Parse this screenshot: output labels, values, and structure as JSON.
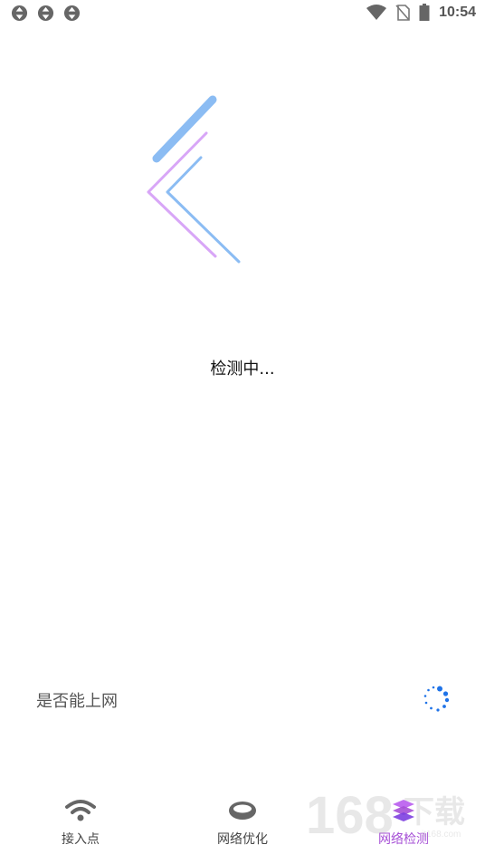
{
  "status_bar": {
    "time": "10:54",
    "left_icons": [
      "sync-icon",
      "sync-icon",
      "sync-icon"
    ],
    "right_icons": [
      "wifi-icon",
      "no-sim-icon",
      "battery-icon"
    ]
  },
  "main": {
    "status_text": "检测中...",
    "check_label": "是否能上网",
    "loading_icon": "loading-spinner-icon"
  },
  "bottom_nav": {
    "items": [
      {
        "label": "接入点",
        "icon": "wifi-icon"
      },
      {
        "label": "网络优化",
        "icon": "ring-icon"
      },
      {
        "label": "网络检测",
        "icon": "layers-icon"
      }
    ],
    "active_index": 2
  },
  "watermark": {
    "text": "168下载",
    "sub": "it168.com"
  },
  "colors": {
    "accent": "#a64fd6",
    "blue": "#8bbcf3",
    "violet": "#d8a6f7",
    "spinner": "#1f73e8"
  }
}
